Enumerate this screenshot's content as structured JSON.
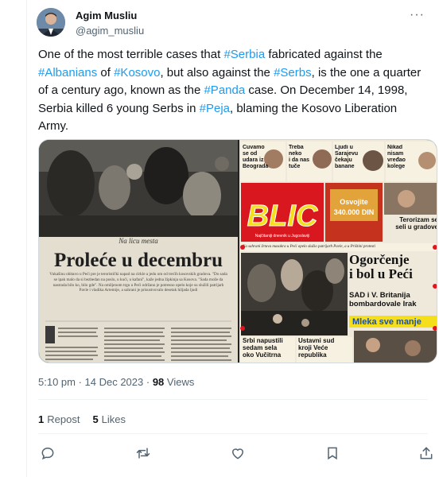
{
  "author": {
    "name": "Agim Musliu",
    "handle": "@agim_musliu"
  },
  "tweet": {
    "segments": [
      {
        "t": "One of the most terrible cases that ",
        "tag": false
      },
      {
        "t": "#Serbia",
        "tag": true
      },
      {
        "t": " fabricated against the ",
        "tag": false
      },
      {
        "t": "#Albanians",
        "tag": true
      },
      {
        "t": " of ",
        "tag": false
      },
      {
        "t": "#Kosovo",
        "tag": true
      },
      {
        "t": ", but also against the ",
        "tag": false
      },
      {
        "t": "#Serbs",
        "tag": true
      },
      {
        "t": ", is the one a quarter of a century ago, known as the ",
        "tag": false
      },
      {
        "t": "#Panda",
        "tag": true
      },
      {
        "t": " case. On December 14, 1998, Serbia killed 6 young Serbs in ",
        "tag": false
      },
      {
        "t": "#Peja",
        "tag": true
      },
      {
        "t": ", blaming the Kosovo Liberation Army.",
        "tag": false
      }
    ]
  },
  "media": {
    "left_page": {
      "kicker": "Na licu mesta",
      "headline": "Proleće u decembru",
      "lead": "Vukašinu obitavo u Peći pre je teroristički napad na cirkle a jedu om od trećih kosovskih gradova. \"Do sada se ipak malo da si bezbedan na poslu, u kući, u kafani\", kaže jedna žipkinja sa Kosova. \"Sada može da nastrada bilo ko, bilo gde\". Na omiljenom trgu u Peći održano je potresno opelo koje su služili patrijarh Pavle i vladika Artemije, a sahrani je prisustvovalo desetak hiljada ljudi"
    },
    "right_page": {
      "top_items": [
        {
          "text": "Čuvamo\nse od\nudara iz\nBeograda"
        },
        {
          "text": "Treba\nneko\ni da nas\ntuče"
        },
        {
          "text": "Ljudi u\nSarajevu\nčekaju\nbanane"
        },
        {
          "text": "Nikad\nnisam\nvređao\nkolege"
        }
      ],
      "masthead": "BLIC",
      "masthead_sub": "Najčitaniji dnevnik u Jugoslaviji",
      "promo": "Osvojite\n340.000 DIN",
      "side_headline": "Terorizam se\nseli u gradove",
      "strip": "Na sahrani žrtava masakra u Peći opelo služio patrijarh Pavle, a u Prištini protesti",
      "main_headline": "Ogorčenje\ni bol u Peći",
      "sub_headline": "SAD i V. Britanija\nbombardovale Irak",
      "yellow_headline": "Mleka sve manje",
      "bottom_items": [
        {
          "text": "Srbi napustili\nsedam sela\noko Vučitrna"
        },
        {
          "text": "Ustavni sud\nkroji Veće\nrepublika"
        }
      ]
    }
  },
  "meta": {
    "time": "5:10 pm · 14 Dec 2023 · ",
    "views_count": "98",
    "views_label": " Views"
  },
  "stats": {
    "reposts_count": "1",
    "reposts_label": "Repost",
    "likes_count": "5",
    "likes_label": "Likes"
  },
  "icons": {
    "reply": "reply-icon",
    "repost": "repost-icon",
    "like": "heart-icon",
    "bookmark": "bookmark-icon",
    "share": "share-icon",
    "more": "more-icon"
  },
  "colors": {
    "accent": "#1d9bf0",
    "muted": "#536471",
    "blic_red": "#d8171f",
    "yellow": "#f4df1a"
  }
}
